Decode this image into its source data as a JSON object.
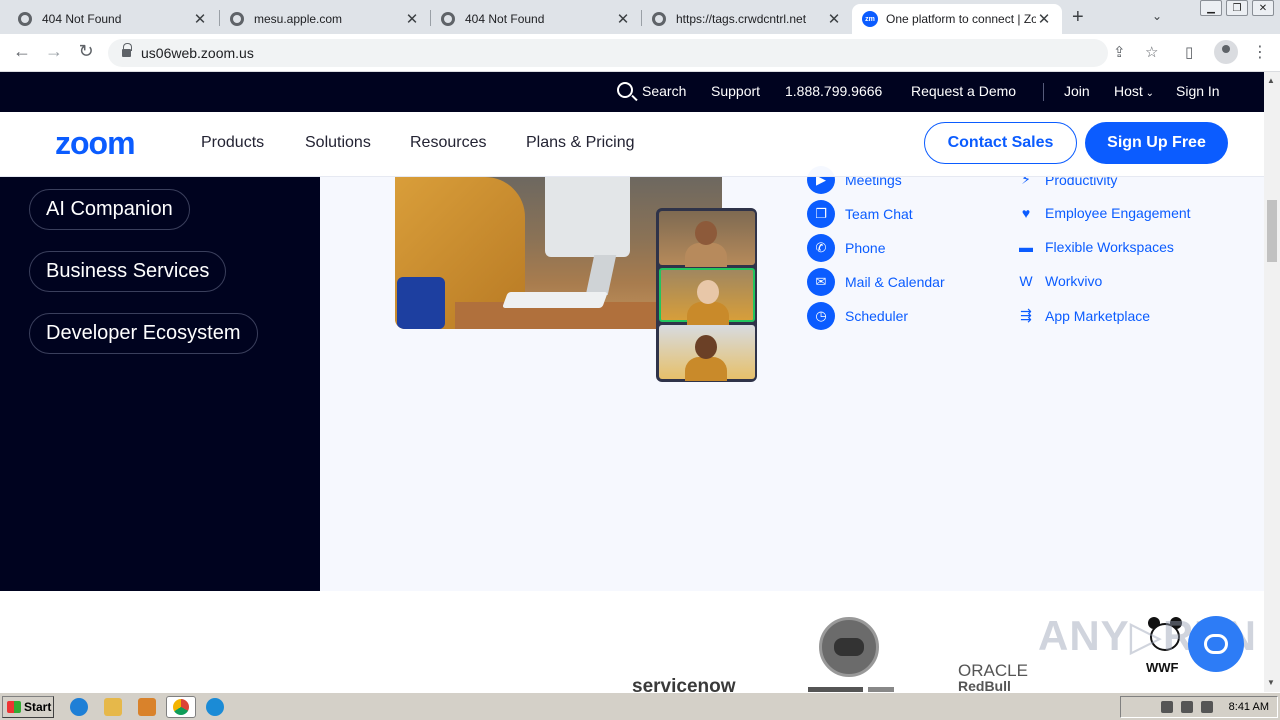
{
  "browser": {
    "tabs": [
      {
        "title": "404 Not Found"
      },
      {
        "title": "mesu.apple.com"
      },
      {
        "title": "404 Not Found"
      },
      {
        "title": "https://tags.crwdcntrl.net"
      },
      {
        "title": "One platform to connect | Zoom",
        "favicon": "zm"
      }
    ],
    "url": "us06web.zoom.us"
  },
  "utility_bar": {
    "search": "Search",
    "support": "Support",
    "phone": "1.888.799.9666",
    "request_demo": "Request a Demo",
    "join": "Join",
    "host": "Host",
    "sign_in": "Sign In"
  },
  "main_nav": {
    "logo": "zoom",
    "links": [
      "Products",
      "Solutions",
      "Resources",
      "Plans & Pricing"
    ],
    "contact_sales": "Contact Sales",
    "sign_up": "Sign Up Free"
  },
  "left_menu": {
    "items": [
      "AI Companion",
      "Business Services",
      "Developer Ecosystem"
    ]
  },
  "features": {
    "left": [
      "Meetings",
      "Team Chat",
      "Phone",
      "Mail & Calendar",
      "Scheduler"
    ],
    "right": [
      "Productivity",
      "Employee Engagement",
      "Flexible Workspaces",
      "Workvivo",
      "App Marketplace"
    ]
  },
  "logos": {
    "servicenow": "servicenow",
    "oracle": "ORACLE",
    "redbull": "RedBull",
    "wwf": "WWF"
  },
  "taskbar": {
    "start": "Start",
    "time": "8:41 AM"
  },
  "colors": {
    "brand_blue": "#0b5cff",
    "dark_navy": "#00031f"
  }
}
